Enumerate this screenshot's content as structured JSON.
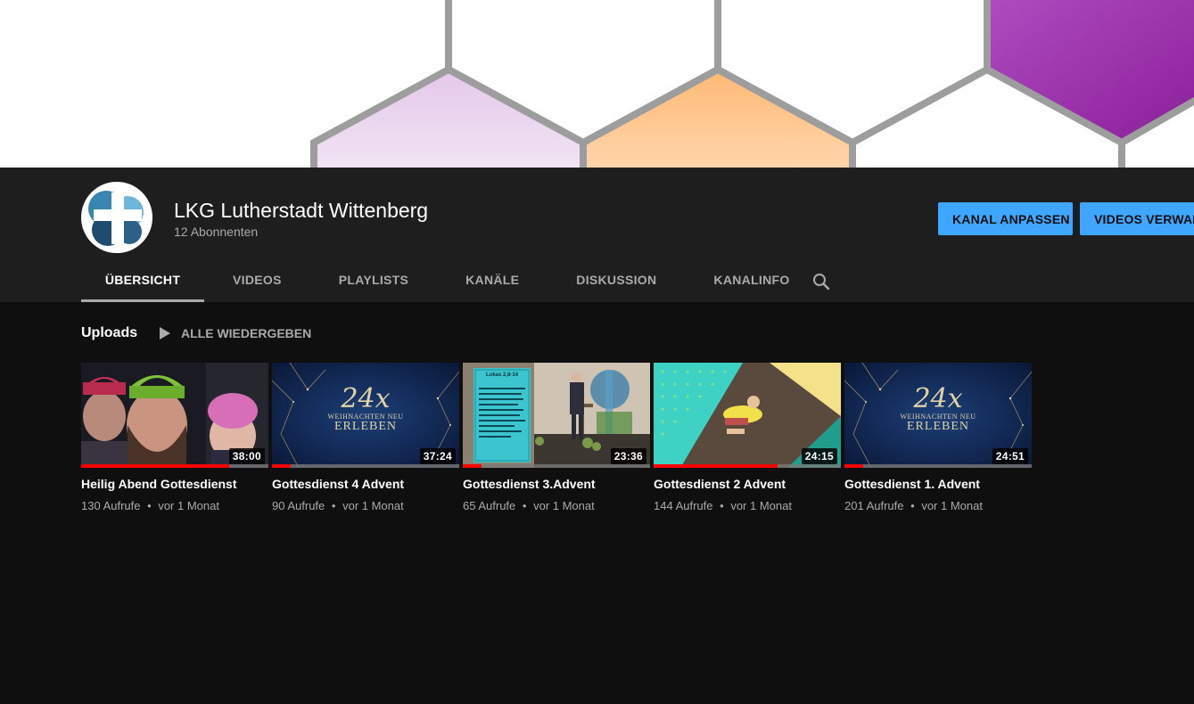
{
  "channel": {
    "name": "LKG Lutherstadt Wittenberg",
    "subscribers": "12 Abonnenten"
  },
  "actions": {
    "customize_label": "KANAL ANPASSEN",
    "manage_label": "VIDEOS VERWALTEN"
  },
  "tabs": [
    {
      "label": "ÜBERSICHT",
      "active": true
    },
    {
      "label": "VIDEOS",
      "active": false
    },
    {
      "label": "PLAYLISTS",
      "active": false
    },
    {
      "label": "KANÄLE",
      "active": false
    },
    {
      "label": "DISKUSSION",
      "active": false
    },
    {
      "label": "KANALINFO",
      "active": false
    }
  ],
  "uploads": {
    "title": "Uploads",
    "play_all_label": "ALLE WIEDERGEBEN",
    "videos": [
      {
        "title": "Heilig Abend Gottesdienst",
        "views": "130 Aufrufe",
        "age": "vor 1 Monat",
        "duration": "38:00",
        "watched": 0.79
      },
      {
        "title": "Gottesdienst 4 Advent",
        "views": "90 Aufrufe",
        "age": "vor 1 Monat",
        "duration": "37:24",
        "watched": 0.1
      },
      {
        "title": "Gottesdienst 3.Advent",
        "views": "65 Aufrufe",
        "age": "vor 1 Monat",
        "duration": "23:36",
        "watched": 0.1
      },
      {
        "title": "Gottesdienst 2 Advent",
        "views": "144 Aufrufe",
        "age": "vor 1 Monat",
        "duration": "24:15",
        "watched": 0.66
      },
      {
        "title": "Gottesdienst 1. Advent",
        "views": "201 Aufrufe",
        "age": "vor 1 Monat",
        "duration": "24:51",
        "watched": 0.1
      }
    ]
  },
  "thumb_text": {
    "big": "24x",
    "small": "WEIHNACHTEN NEU",
    "brand": "ERLEBEN",
    "slide_heading": "Lukas 2,8-14"
  },
  "separator": "•",
  "colors": {
    "background": "#0f0f0f",
    "header": "#1e1e1e",
    "accent": "#3ea6ff",
    "progress": "#ff0000"
  },
  "icons": {
    "search": "search-icon",
    "play": "play-icon"
  }
}
